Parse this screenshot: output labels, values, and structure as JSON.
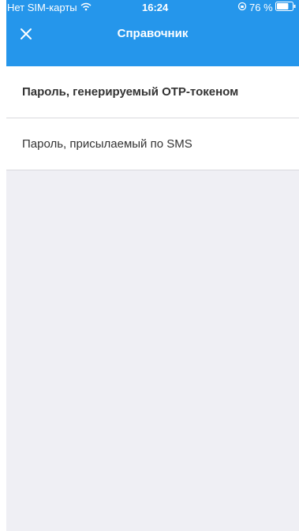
{
  "status_bar": {
    "carrier": "Нет SIM-карты",
    "time": "16:24",
    "battery_percent": "76 %",
    "battery_level": 0.76
  },
  "nav": {
    "title": "Справочник"
  },
  "items": [
    {
      "label": "Пароль, генерируемый OTP-токеном"
    },
    {
      "label": "Пароль, присылаемый по SMS"
    }
  ],
  "colors": {
    "accent": "#2596eb"
  }
}
